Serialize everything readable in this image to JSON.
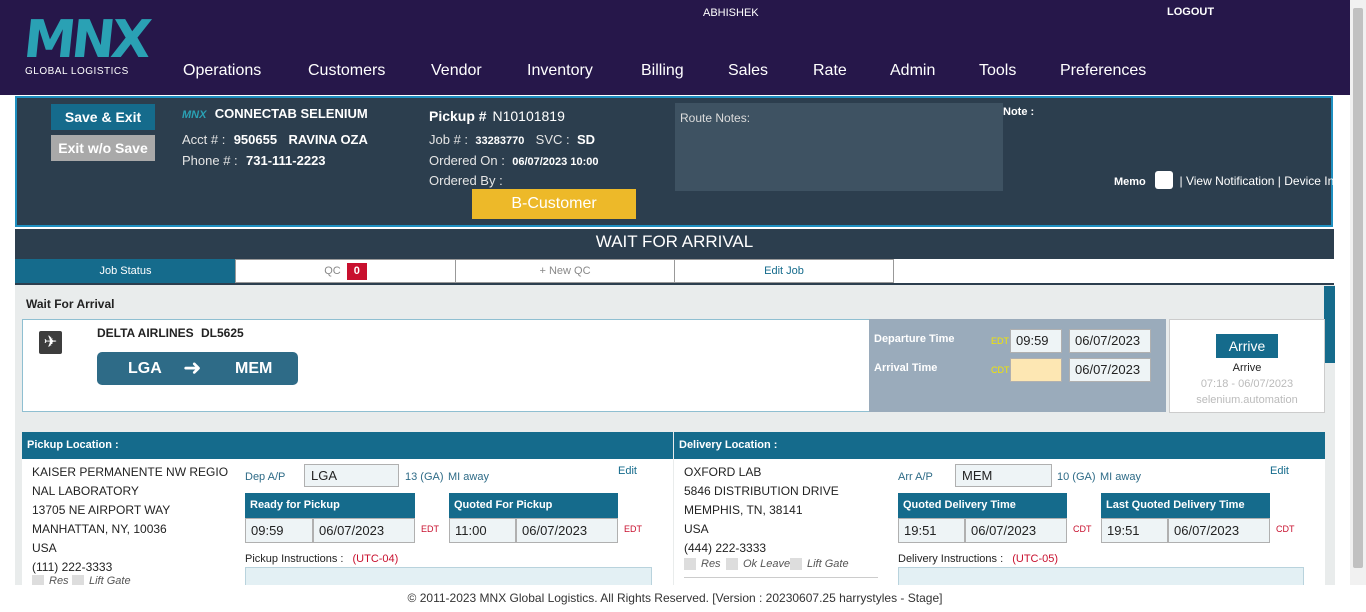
{
  "brand": {
    "logo": "MNX",
    "tagline": "GLOBAL LOGISTICS"
  },
  "user": {
    "name": "ABHISHEK",
    "logout": "LOGOUT"
  },
  "nav": [
    "Operations",
    "Customers",
    "Vendor",
    "Inventory",
    "Billing",
    "Sales",
    "Rate",
    "Admin",
    "Tools",
    "Preferences"
  ],
  "header": {
    "save_exit": "Save & Exit",
    "exit_wo_save": "Exit w/o Save",
    "mnx_tag": "MNX",
    "customer": "CONNECTAB SELENIUM",
    "acct_label": "Acct # :",
    "acct_no": "950655",
    "acct_name": "RAVINA OZA",
    "phone_label": "Phone # :",
    "phone": "731-111-2223",
    "pickup_label": "Pickup #",
    "pickup_no": "N10101819",
    "job_label": "Job # :",
    "job_no": "33283770",
    "svc_label": "SVC :",
    "svc": "SD",
    "ordered_on_label": "Ordered On :",
    "ordered_on": "06/07/2023 10:00",
    "ordered_by_label": "Ordered By :",
    "customer_type": "B-Customer",
    "route_notes_label": "Route Notes:",
    "note_label": "Note :",
    "memo": "Memo",
    "view_notification": "View Notification",
    "device_info": "Device Info",
    "sep": "|"
  },
  "status_title": "WAIT FOR ARRIVAL",
  "tabs": {
    "job_status": "Job Status",
    "qc": "QC",
    "qc_count": "0",
    "new_qc": "+ New QC",
    "edit_job": "Edit Job"
  },
  "wait": {
    "label": "Wait For Arrival",
    "airline": "DELTA AIRLINES",
    "flight": "DL5625",
    "from": "LGA",
    "to": "MEM",
    "departure_label": "Departure Time",
    "departure_tz": "EDT",
    "departure_time": "09:59",
    "departure_date": "06/07/2023",
    "arrival_label": "Arrival Time",
    "arrival_tz": "CDT",
    "arrival_time": "",
    "arrival_date": "06/07/2023",
    "arrive_button": "Arrive",
    "arrive_status": "Arrive",
    "arrive_stamp": "07:18 - 06/07/2023",
    "arrive_user": "selenium.automation"
  },
  "pickup": {
    "header": "Pickup Location :",
    "address": [
      "KAISER PERMANENTE NW REGIO",
      "NAL LABORATORY",
      "13705 NE AIRPORT WAY",
      "MANHATTAN, NY, 10036",
      "USA",
      "(111) 222-3333"
    ],
    "ap_label": "Dep A/P",
    "ap": "LGA",
    "ga": "13 (GA)",
    "away": "MI away",
    "edit": "Edit",
    "ready_label": "Ready for Pickup",
    "ready_time": "09:59",
    "ready_date": "06/07/2023",
    "ready_tz": "EDT",
    "quoted_label": "Quoted For Pickup",
    "quoted_time": "11:00",
    "quoted_date": "06/07/2023",
    "quoted_tz": "EDT",
    "instructions_label": "Pickup Instructions :",
    "utc": "(UTC-04)",
    "res": "Res",
    "lift_gate": "Lift Gate"
  },
  "delivery": {
    "header": "Delivery Location :",
    "address": [
      "OXFORD LAB",
      "5846 DISTRIBUTION DRIVE",
      "MEMPHIS, TN, 38141",
      "USA",
      "(444) 222-3333"
    ],
    "ap_label": "Arr A/P",
    "ap": "MEM",
    "ga": "10 (GA)",
    "away": "MI away",
    "edit": "Edit",
    "quoted_label": "Quoted Delivery Time",
    "quoted_time": "19:51",
    "quoted_date": "06/07/2023",
    "quoted_tz": "CDT",
    "last_label": "Last Quoted Delivery Time",
    "last_time": "19:51",
    "last_date": "06/07/2023",
    "last_tz": "CDT",
    "instructions_label": "Delivery Instructions :",
    "utc": "(UTC-05)",
    "res": "Res",
    "ok_leave": "Ok Leave",
    "lift_gate": "Lift Gate"
  },
  "footer": "© 2011-2023 MNX Global Logistics. All Rights Reserved. [Version : 20230607.25 harrystyles - Stage]"
}
